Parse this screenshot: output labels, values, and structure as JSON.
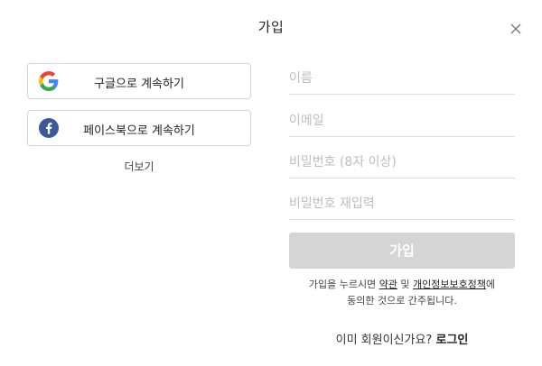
{
  "dialog": {
    "title": "가입",
    "close_icon": "close-icon"
  },
  "social": {
    "google_label": "구글으로 계속하기",
    "google_icon": "google-icon",
    "facebook_label": "페이스북으로 계속하기",
    "facebook_icon": "facebook-icon",
    "facebook_color": "#3b5998",
    "more_label": "더보기"
  },
  "form": {
    "name_placeholder": "이름",
    "email_placeholder": "이메일",
    "password_placeholder": "비밀번호 (8자 이상)",
    "password_confirm_placeholder": "비밀번호 재입력",
    "name_value": "",
    "email_value": "",
    "password_value": "",
    "password_confirm_value": "",
    "submit_label": "가입",
    "submit_color": "#d5d5d5"
  },
  "terms": {
    "prefix": "가입을 누르시면 ",
    "terms_link": "약관",
    "and": " 및 ",
    "privacy_link": "개인정보보호정책",
    "suffix_line1": "에",
    "line2": "동의한 것으로 간주됩니다."
  },
  "login": {
    "question": "이미 회원이신가요? ",
    "link": "로그인"
  }
}
